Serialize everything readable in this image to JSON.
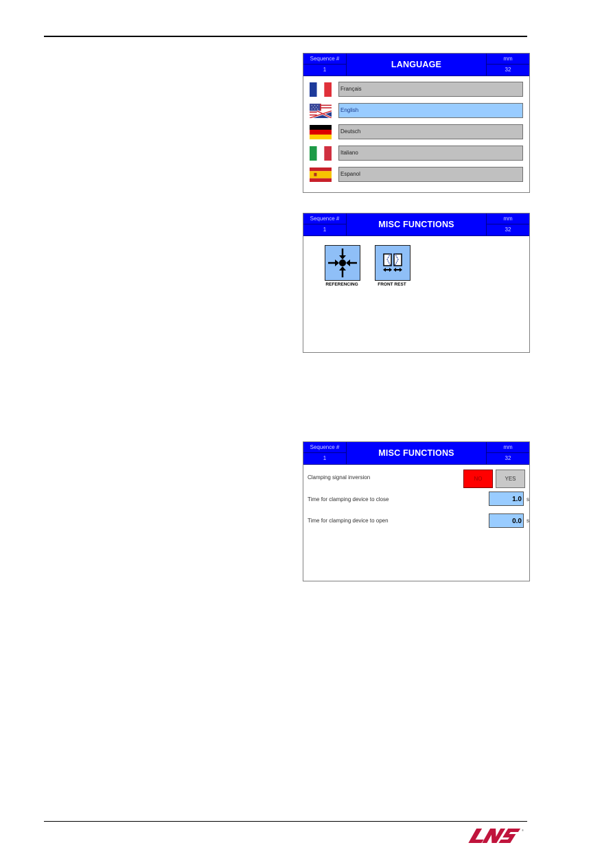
{
  "screens": [
    {
      "header": {
        "sequence_label": "Sequence #",
        "sequence_value": "1",
        "title": "LANGUAGE",
        "unit_label": "mm",
        "unit_value": "32"
      },
      "languages": [
        {
          "label": "Français",
          "flag": "flag-france-icon",
          "selected": false
        },
        {
          "label": "English",
          "flag": "flag-uk-us-icon",
          "selected": true
        },
        {
          "label": "Deutsch",
          "flag": "flag-germany-icon",
          "selected": false
        },
        {
          "label": "Italiano",
          "flag": "flag-italy-icon",
          "selected": false
        },
        {
          "label": "Espanol",
          "flag": "flag-spain-icon",
          "selected": false
        }
      ]
    },
    {
      "header": {
        "sequence_label": "Sequence #",
        "sequence_value": "1",
        "title": "MISC FUNCTIONS",
        "unit_label": "mm",
        "unit_value": "32"
      },
      "tiles": [
        {
          "label": "REFERENCING",
          "icon": "referencing-icon"
        },
        {
          "label": "FRONT REST",
          "icon": "front-rest-icon"
        }
      ]
    },
    {
      "header": {
        "sequence_label": "Sequence #",
        "sequence_value": "1",
        "title": "MISC FUNCTIONS",
        "unit_label": "mm",
        "unit_value": "32"
      },
      "clamping_inversion": {
        "label": "Clamping signal inversion",
        "no_label": "NO",
        "yes_label": "YES",
        "selected": "NO"
      },
      "close_time": {
        "label": "Time for clamping device to close",
        "value": "1.0",
        "unit": "s"
      },
      "open_time": {
        "label": "Time for clamping device to open",
        "value": "0.0",
        "unit": "s"
      }
    }
  ],
  "footer": {
    "logo": "LNS"
  },
  "colors": {
    "header_blue": "#0000ff",
    "selected_blue": "#99ccff",
    "button_grey": "#c0c0c0",
    "no_red": "#ff0000",
    "logo_red": "#c0143c"
  }
}
